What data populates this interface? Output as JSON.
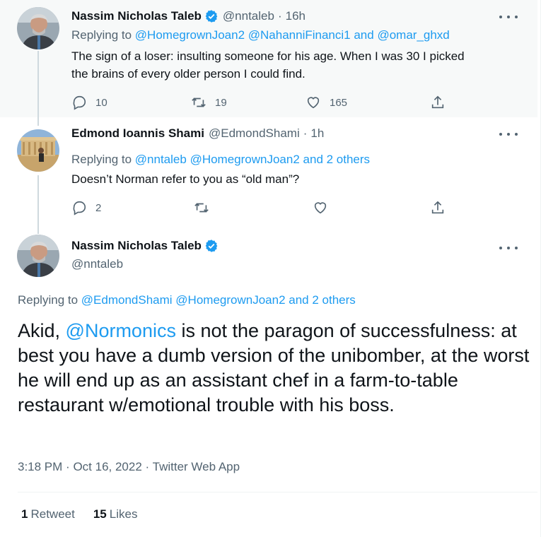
{
  "colors": {
    "accent": "#1d9bf0",
    "secondary_text": "#536471",
    "highlight_bg": "#f7f9f9"
  },
  "tweets": [
    {
      "name": "Nassim Nicholas Taleb",
      "verified": true,
      "handle": "@nntaleb",
      "separator": "·",
      "time": "16h",
      "replying_prefix": "Replying to",
      "replying_to": [
        "@HomegrownJoan2",
        "@NahanniFinanci1"
      ],
      "replying_and": "and",
      "replying_last": "@omar_ghxd",
      "text_lines": [
        "The sign of a loser: insulting someone for his age. When I was 30 I picked",
        "the brains of every older person I could find."
      ],
      "replies": "10",
      "retweets": "19",
      "likes": "165"
    },
    {
      "name": "Edmond Ioannis Shami",
      "verified": false,
      "handle": "@EdmondShami",
      "separator": "·",
      "time": "1h",
      "replying_prefix": "Replying to",
      "replying_to": [
        "@nntaleb",
        "@HomegrownJoan2"
      ],
      "replying_and": "and 2 others",
      "text": "Doesn’t Norman refer to you as “old man”?",
      "replies": "2"
    }
  ],
  "main_tweet": {
    "name": "Nassim Nicholas Taleb",
    "verified": true,
    "handle": "@nntaleb",
    "replying_prefix": "Replying to",
    "replying_to": [
      "@EdmondShami",
      "@HomegrownJoan2"
    ],
    "replying_and": "and 2 others",
    "text_prefix": "Akid, ",
    "mention": "@Normonics",
    "text_rest": " is not the paragon of successfulness: at best you have a dumb version of the unibomber, at the worst he will end up as an assistant chef in a farm-to-table restaurant w/emotional trouble with his boss.",
    "time": "3:18 PM",
    "date": "Oct 16, 2022",
    "source": "Twitter Web App",
    "meta_separator": "·",
    "retweet_count": "1",
    "retweet_label": "Retweet",
    "like_count": "15",
    "like_label": "Likes"
  },
  "icons": [
    "verified-badge-icon",
    "more-icon",
    "reply-icon",
    "retweet-icon",
    "like-icon",
    "share-icon"
  ]
}
